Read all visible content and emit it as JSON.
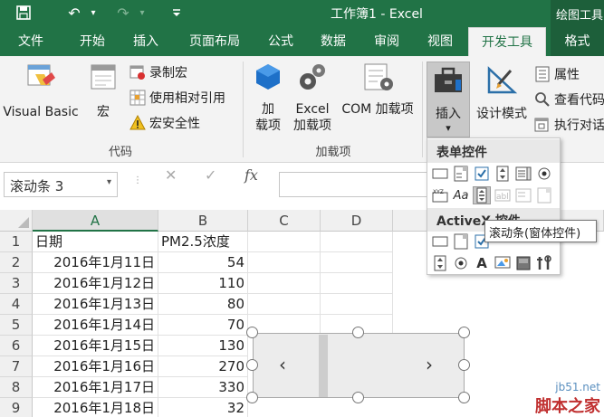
{
  "window": {
    "title": "工作簿1 - Excel",
    "context_tab_group": "绘图工具"
  },
  "tabs": [
    {
      "label": "文件"
    },
    {
      "label": "开始"
    },
    {
      "label": "插入"
    },
    {
      "label": "页面布局"
    },
    {
      "label": "公式"
    },
    {
      "label": "数据"
    },
    {
      "label": "审阅"
    },
    {
      "label": "视图"
    },
    {
      "label": "开发工具",
      "active": true
    },
    {
      "label": "格式"
    }
  ],
  "ribbon": {
    "code_group": {
      "label": "代码",
      "visual_basic": "Visual Basic",
      "macros": "宏",
      "record_macro": "录制宏",
      "use_relative_refs": "使用相对引用",
      "macro_security": "宏安全性"
    },
    "addins_group": {
      "label": "加载项",
      "addins_line1": "加",
      "addins_line2": "载项",
      "excel_addins_line1": "Excel",
      "excel_addins_line2": "加载项",
      "com_addins": "COM 加载项"
    },
    "controls_group": {
      "insert": "插入",
      "insert_arrow": "▾",
      "design_mode": "设计模式",
      "properties": "属性",
      "view_code": "查看代码",
      "run_dialog": "执行对话"
    }
  },
  "formula_bar": {
    "name_box": "滚动条 3",
    "cancel_icon": "✕",
    "enter_icon": "✓",
    "fx_icon": "fx"
  },
  "insert_dropdown": {
    "form_controls_label": "表单控件",
    "activex_label": "ActiveX 控件",
    "tooltip": "滚动条(窗体控件)"
  },
  "sheet": {
    "columns": [
      "A",
      "B",
      "C",
      "D"
    ],
    "rows": [
      "1",
      "2",
      "3",
      "4",
      "5",
      "6",
      "7",
      "8",
      "9"
    ],
    "cells": [
      [
        "日期",
        "PM2.5浓度"
      ],
      [
        "2016年1月11日",
        "54"
      ],
      [
        "2016年1月12日",
        "110"
      ],
      [
        "2016年1月13日",
        "80"
      ],
      [
        "2016年1月14日",
        "70"
      ],
      [
        "2016年1月15日",
        "130"
      ],
      [
        "2016年1月16日",
        "270"
      ],
      [
        "2016年1月17日",
        "330"
      ],
      [
        "2016年1月18日",
        "32"
      ]
    ]
  },
  "scrollbar_control": {
    "left_arrow": "‹",
    "right_arrow": "›"
  },
  "watermark": {
    "line1": "jb51.net",
    "line2": "脚本之家"
  }
}
